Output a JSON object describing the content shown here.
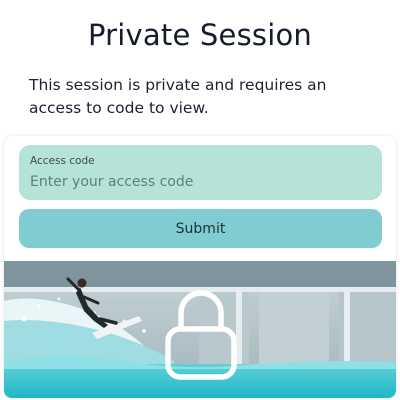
{
  "header": {
    "title": "Private Session",
    "description": "This session is private and requires an access to code to view."
  },
  "form": {
    "access_code_label": "Access code",
    "access_code_placeholder": "Enter your access code",
    "access_code_value": "",
    "submit_label": "Submit"
  },
  "preview": {
    "image_subject": "surfer-riding-wave-pool",
    "overlay_icon": "lock-icon"
  },
  "colors": {
    "field_bg": "#b5e3d7",
    "button_bg": "#7fccd1",
    "water": "#2fc3cf",
    "title_text": "#141c2e"
  }
}
